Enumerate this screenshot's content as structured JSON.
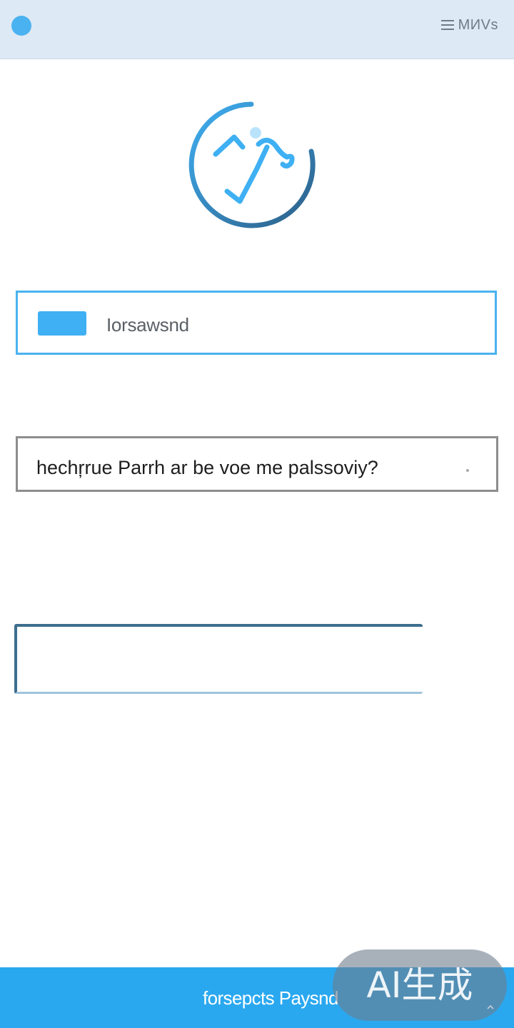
{
  "topbar": {
    "menu_label": "MИVs",
    "accent_color": "#4ab2f0",
    "background_color": "#dde9f4"
  },
  "logo": {
    "icon": "checkmark-circle-icon",
    "color_light": "#3fb0f3",
    "color_dark": "#2d5f87"
  },
  "form": {
    "username": {
      "value": "Iorsawsnd",
      "chip_icon": "account-chip-icon",
      "border_color": "#4ab2f0"
    },
    "password": {
      "value": "hechŗrue Parrh ar be voe me palssoviy?",
      "border_color": "#8d8d8d"
    },
    "empty_box_label": ""
  },
  "footer": {
    "forgot_link": "forsepcts Paysnd",
    "background_color": "#2aa8ef"
  },
  "badge": {
    "label": "AI生成"
  }
}
